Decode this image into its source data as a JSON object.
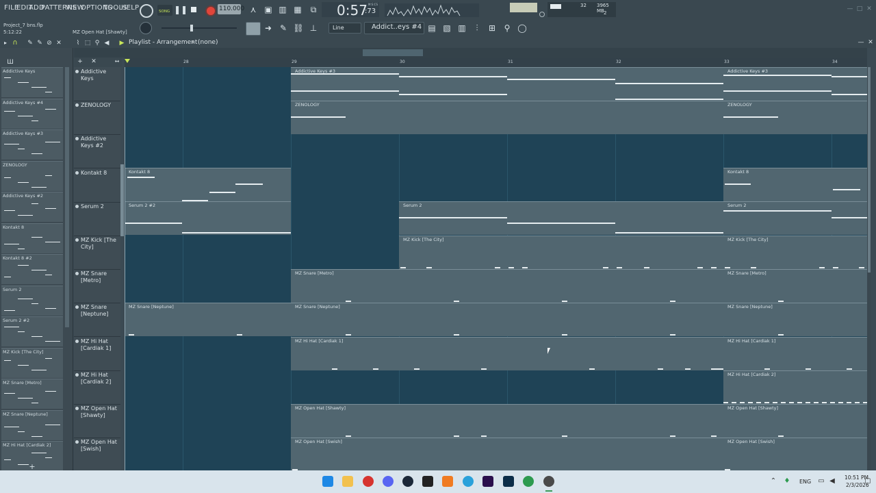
{
  "menu": [
    "FILE",
    "EDIT",
    "ADD",
    "PATTERNS",
    "VIEW",
    "OPTIONS",
    "TOOLS",
    "HELP"
  ],
  "project": {
    "file": "Project_7 bns.flp",
    "time": "5:12:22",
    "hint": "MZ Open Hat [Shawty]"
  },
  "transport": {
    "mode": "SONG",
    "tempo": "110.000",
    "clock": "0:57",
    "clock_small": ":73",
    "clock_label": "M:S:CS"
  },
  "cpu": {
    "cpu_value": "32",
    "memory": "3965 MB",
    "voices": "2"
  },
  "toolbar": {
    "snap": "Line",
    "pattern": "Addict..eys #4"
  },
  "playlist": {
    "title": "Playlist - Arrangement",
    "arrangement": "(none)"
  },
  "ruler": [
    "28",
    "29",
    "30",
    "31",
    "32",
    "33",
    "34"
  ],
  "browser_items": [
    "Addictive Keys",
    "Addictive Keys #4",
    "Addictive Keys #3",
    "ZENOLOGY",
    "Addictive Keys #2",
    "Kontakt 8",
    "Kontakt 8 #2",
    "Serum 2",
    "Serum 2 #2",
    "MZ Kick [The City]",
    "MZ Snare [Metro]",
    "MZ Snare [Neptune]",
    "MZ Hi Hat [Cardiak 2]"
  ],
  "tracks": [
    "Addictive Keys",
    "ZENOLOGY",
    "Addictive Keys #2",
    "Kontakt 8",
    "Serum 2",
    "MZ Kick [The City]",
    "MZ Snare [Metro]",
    "MZ Snare [Neptune]",
    "MZ Hi Hat [Cardiak 1]",
    "MZ Hi Hat [Cardiak 2]",
    "MZ Open Hat [Shawty]",
    "MZ Open Hat [Swish]"
  ],
  "clips": {
    "addictive3": "Addictive Keys #3",
    "zenology": "ZENOLOGY",
    "kontakt": "Kontakt 8",
    "serum2_2": "Serum 2 #2",
    "serum2": "Serum 2",
    "kick": "MZ Kick [The City]",
    "snare_metro": "MZ Snare [Metro]",
    "snare_neptune": "MZ Snare [Neptune]",
    "hat1": "MZ Hi Hat [Cardiak 1]",
    "hat2": "MZ Hi Hat [Cardiak 2]",
    "open_shawty": "MZ Open Hat [Shawty]",
    "open_swish": "MZ Open Hat [Swish]"
  },
  "taskbar": {
    "lang": "ENG",
    "time": "10:51 PM",
    "date": "2/3/2026"
  },
  "colors": {
    "grid_bg": "#1f4356",
    "clip": "#516670",
    "accent": "#c8e65a",
    "record": "#e0453a"
  }
}
